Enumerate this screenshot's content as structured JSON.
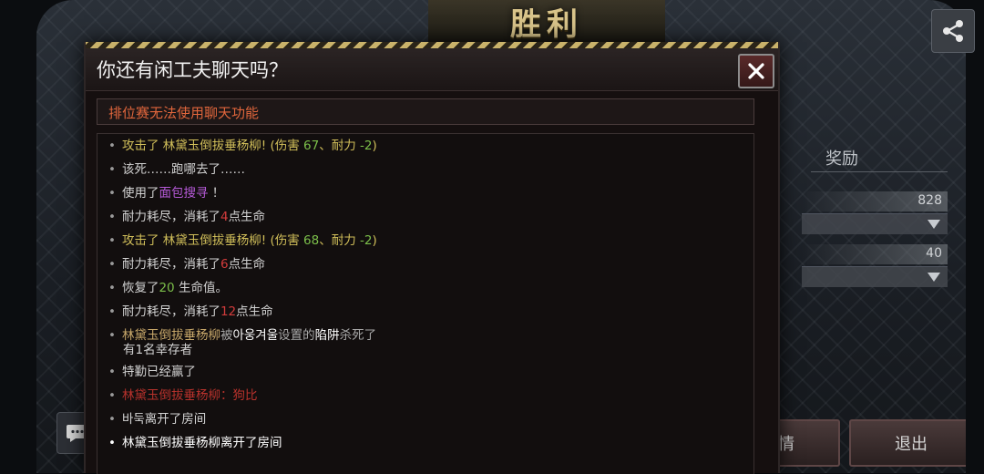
{
  "background": {
    "victory_title": "胜利",
    "share_icon": "share-icon",
    "reward_title": "奖励",
    "reward_values": [
      "828",
      "40"
    ],
    "details_label": "详情",
    "exit_label": "退出",
    "chat_icon": "chat-bubble-icon"
  },
  "dialog": {
    "title": "你还有闲工夫聊天吗？",
    "close_icon": "close-icon",
    "notice": "排位赛无法使用聊天功能",
    "messages": [
      {
        "parts": [
          "攻击了 林黛玉倒拔垂杨柳! (伤害 ",
          "67",
          "、耐力 ",
          "-2",
          ")"
        ]
      },
      {
        "parts": [
          "该死……跑哪去了……"
        ]
      },
      {
        "parts": [
          "使用了",
          "面包搜寻",
          " ！"
        ]
      },
      {
        "parts": [
          "耐力耗尽，消耗了",
          "4",
          "点生命"
        ]
      },
      {
        "parts": [
          "攻击了 林黛玉倒拔垂杨柳! (伤害 ",
          "68",
          "、耐力 ",
          "-2",
          ")"
        ]
      },
      {
        "parts": [
          "耐力耗尽，消耗了",
          "6",
          "点生命"
        ]
      },
      {
        "parts": [
          "恢复了",
          "20",
          " 生命值。"
        ]
      },
      {
        "parts": [
          "耐力耗尽，消耗了",
          "12",
          "点生命"
        ]
      },
      {
        "parts": [
          "林黛玉倒拔垂杨柳",
          "被",
          "아웅겨울",
          "设置的",
          "陷阱",
          "杀死了",
          "有1名幸存者"
        ]
      },
      {
        "parts": [
          "特勤已经赢了"
        ]
      },
      {
        "parts": [
          "林黛玉倒拔垂杨柳：狗比"
        ]
      },
      {
        "parts": [
          "바둑离开了房间"
        ]
      },
      {
        "parts": [
          "林黛玉倒拔垂杨柳离开了房间"
        ]
      }
    ]
  },
  "colors": {
    "title_gold": "#d9c48a",
    "notice_orange": "#e0663c",
    "damage_yellow": "#d1bf5a",
    "heal_green": "#7cbf4a",
    "item_purple": "#b65ad8",
    "hp_red": "#d43c3c"
  }
}
